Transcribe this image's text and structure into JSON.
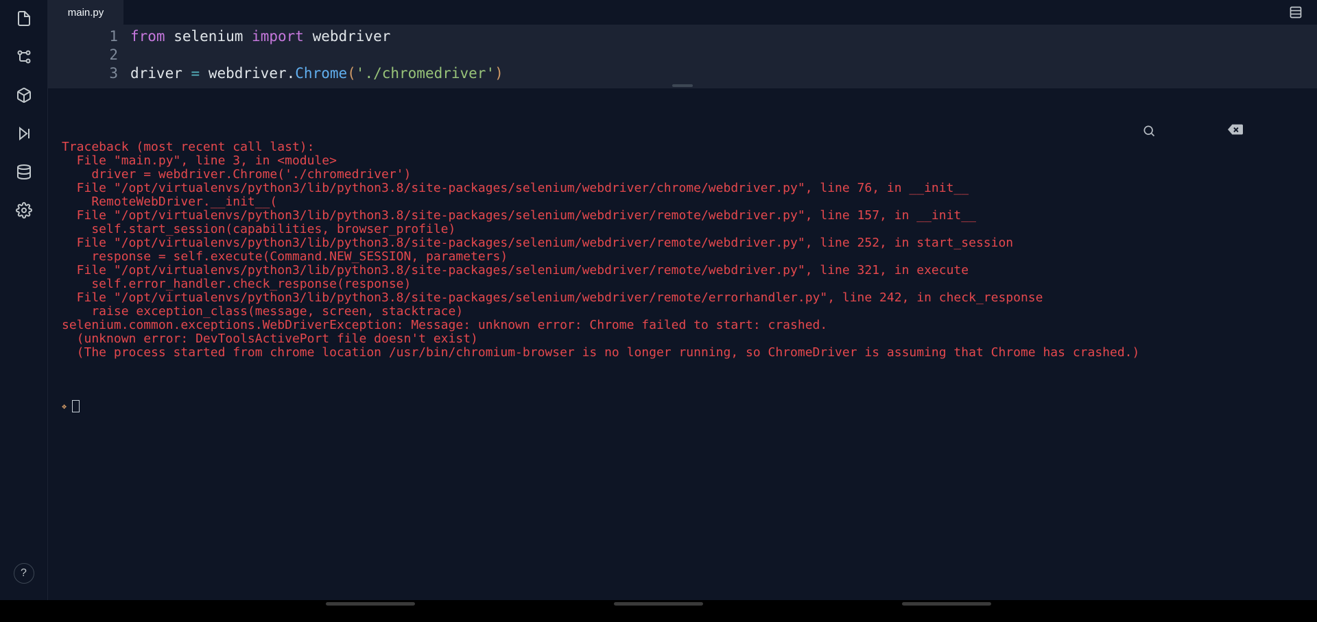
{
  "tabs": {
    "active": "main.py"
  },
  "editor": {
    "line_numbers": [
      "1",
      "2",
      "3"
    ],
    "code": [
      [
        {
          "t": "from",
          "c": "kw"
        },
        {
          "t": " ",
          "c": "id"
        },
        {
          "t": "selenium",
          "c": "id"
        },
        {
          "t": " ",
          "c": "id"
        },
        {
          "t": "import",
          "c": "kw"
        },
        {
          "t": " ",
          "c": "id"
        },
        {
          "t": "webdriver",
          "c": "id"
        }
      ],
      [],
      [
        {
          "t": "driver",
          "c": "id"
        },
        {
          "t": " ",
          "c": "id"
        },
        {
          "t": "=",
          "c": "op"
        },
        {
          "t": " ",
          "c": "id"
        },
        {
          "t": "webdriver",
          "c": "id"
        },
        {
          "t": ".",
          "c": "id"
        },
        {
          "t": "Chrome",
          "c": "cls"
        },
        {
          "t": "(",
          "c": "paren"
        },
        {
          "t": "'./chromedriver'",
          "c": "str"
        },
        {
          "t": ")",
          "c": "paren"
        }
      ]
    ]
  },
  "console": {
    "lines": [
      "Traceback (most recent call last):",
      "  File \"main.py\", line 3, in <module>",
      "    driver = webdriver.Chrome('./chromedriver')",
      "  File \"/opt/virtualenvs/python3/lib/python3.8/site-packages/selenium/webdriver/chrome/webdriver.py\", line 76, in __init__",
      "    RemoteWebDriver.__init__(",
      "  File \"/opt/virtualenvs/python3/lib/python3.8/site-packages/selenium/webdriver/remote/webdriver.py\", line 157, in __init__",
      "    self.start_session(capabilities, browser_profile)",
      "  File \"/opt/virtualenvs/python3/lib/python3.8/site-packages/selenium/webdriver/remote/webdriver.py\", line 252, in start_session",
      "    response = self.execute(Command.NEW_SESSION, parameters)",
      "  File \"/opt/virtualenvs/python3/lib/python3.8/site-packages/selenium/webdriver/remote/webdriver.py\", line 321, in execute",
      "    self.error_handler.check_response(response)",
      "  File \"/opt/virtualenvs/python3/lib/python3.8/site-packages/selenium/webdriver/remote/errorhandler.py\", line 242, in check_response",
      "    raise exception_class(message, screen, stacktrace)",
      "selenium.common.exceptions.WebDriverException: Message: unknown error: Chrome failed to start: crashed.",
      "  (unknown error: DevToolsActivePort file doesn't exist)",
      "  (The process started from chrome location /usr/bin/chromium-browser is no longer running, so ChromeDriver is assuming that Chrome has crashed.)"
    ]
  },
  "help_label": "?"
}
